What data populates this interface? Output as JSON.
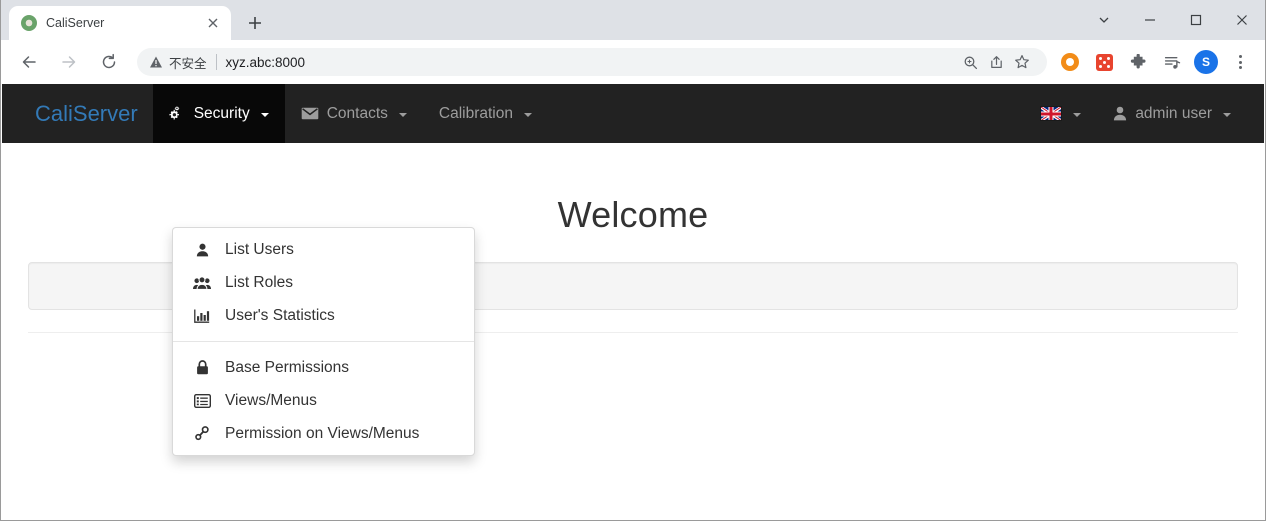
{
  "browser": {
    "tab": {
      "title": "CaliServer",
      "favicon": "globe-favicon",
      "close_label": "×"
    },
    "new_tab_label": "new-tab",
    "window_controls": {
      "tab_search": "tab-search",
      "minimize": "minimize",
      "maximize": "maximize",
      "close": "close"
    },
    "toolbar": {
      "back": "back",
      "forward": "forward",
      "reload": "reload",
      "omnibox": {
        "security_text": "不安全",
        "url": "xyz.abc:8000",
        "zoom_icon": "zoom-icon",
        "share_icon": "share-icon",
        "bookmark_icon": "bookmark-star-icon"
      },
      "extensions": [
        {
          "name": "orange-circle-extension"
        },
        {
          "name": "red-dice-extension"
        },
        {
          "name": "puzzle-extensions-icon"
        },
        {
          "name": "reading-list-icon"
        }
      ],
      "profile_initial": "S",
      "menu": "chrome-menu"
    }
  },
  "app": {
    "brand": "CaliServer",
    "nav": [
      {
        "label": "Security",
        "icon": "cogs-icon",
        "active": true,
        "caret": true
      },
      {
        "label": "Contacts",
        "icon": "envelope-icon",
        "active": false,
        "caret": true
      },
      {
        "label": "Calibration",
        "icon": "",
        "active": false,
        "caret": true
      }
    ],
    "right_nav": {
      "language": {
        "label": "",
        "icon": "uk-flag-icon",
        "caret": true
      },
      "user": {
        "label": "admin user",
        "icon": "user-icon",
        "caret": true
      }
    },
    "dropdown": {
      "open_for": "Security",
      "groups": [
        {
          "items": [
            {
              "label": "List Users",
              "icon": "user-icon"
            },
            {
              "label": "List Roles",
              "icon": "users-group-icon"
            },
            {
              "label": "User's Statistics",
              "icon": "bar-chart-icon"
            }
          ]
        },
        {
          "items": [
            {
              "label": "Base Permissions",
              "icon": "lock-icon"
            },
            {
              "label": "Views/Menus",
              "icon": "list-alt-icon"
            },
            {
              "label": "Permission on Views/Menus",
              "icon": "link-chain-icon"
            }
          ]
        }
      ]
    },
    "content": {
      "heading": "Welcome",
      "well_text": ""
    },
    "colors": {
      "navbar_bg": "#222222",
      "navbar_active_bg": "#080808",
      "brand": "#337ab7",
      "nav_link": "#9d9d9d",
      "well_bg": "#f5f5f5",
      "text": "#333333"
    }
  }
}
